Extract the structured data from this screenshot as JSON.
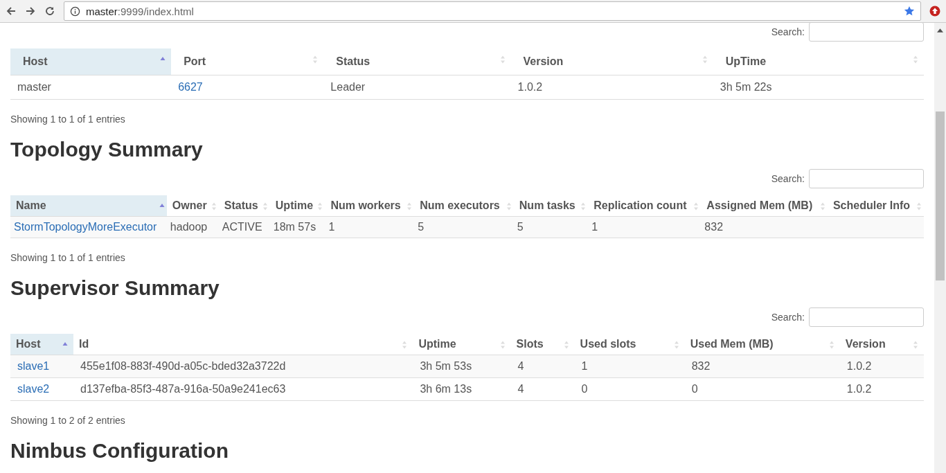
{
  "browser": {
    "url_host": "master",
    "url_rest": ":9999/index.html"
  },
  "sections": [
    {
      "search_label": "Search:",
      "table": {
        "columns": [
          {
            "label": "Host",
            "sorted": true,
            "link": false
          },
          {
            "label": "Port",
            "sorted": false,
            "link": true
          },
          {
            "label": "Status",
            "sorted": false,
            "link": false
          },
          {
            "label": "Version",
            "sorted": false,
            "link": false
          },
          {
            "label": "UpTime",
            "sorted": false,
            "link": false
          }
        ],
        "rows": [
          [
            "master",
            "6627",
            "Leader",
            "1.0.2",
            "3h 5m 22s"
          ]
        ]
      },
      "info": "Showing 1 to 1 of 1 entries"
    },
    {
      "heading": "Topology Summary",
      "search_label": "Search:",
      "table": {
        "columns": [
          {
            "label": "Name",
            "sorted": true,
            "link": true
          },
          {
            "label": "Owner",
            "sorted": false,
            "link": false
          },
          {
            "label": "Status",
            "sorted": false,
            "link": false
          },
          {
            "label": "Uptime",
            "sorted": false,
            "link": false
          },
          {
            "label": "Num workers",
            "sorted": false,
            "link": false
          },
          {
            "label": "Num executors",
            "sorted": false,
            "link": false
          },
          {
            "label": "Num tasks",
            "sorted": false,
            "link": false
          },
          {
            "label": "Replication count",
            "sorted": false,
            "link": false
          },
          {
            "label": "Assigned Mem (MB)",
            "sorted": false,
            "link": false
          },
          {
            "label": "Scheduler Info",
            "sorted": false
          }
        ],
        "rows": [
          [
            "StormTopologyMoreExecutor",
            "hadoop",
            "ACTIVE",
            "18m 57s",
            "1",
            "5",
            "5",
            "1",
            "832",
            ""
          ]
        ]
      },
      "info": "Showing 1 to 1 of 1 entries"
    },
    {
      "heading": "Supervisor Summary",
      "search_label": "Search:",
      "table": {
        "columns": [
          {
            "label": "Host",
            "sorted": true,
            "link": true
          },
          {
            "label": "Id",
            "sorted": false,
            "link": false
          },
          {
            "label": "Uptime",
            "sorted": false,
            "link": false
          },
          {
            "label": "Slots",
            "sorted": false,
            "link": false
          },
          {
            "label": "Used slots",
            "sorted": false,
            "link": false
          },
          {
            "label": "Used Mem (MB)",
            "sorted": false,
            "link": false
          },
          {
            "label": "Version",
            "sorted": false,
            "link": false
          }
        ],
        "rows": [
          [
            "slave1",
            "455e1f08-883f-490d-a05c-bded32a3722d",
            "3h 5m 53s",
            "4",
            "1",
            "832",
            "1.0.2"
          ],
          [
            "slave2",
            "d137efba-85f3-487a-916a-50a9e241ec63",
            "3h 6m 13s",
            "4",
            "0",
            "0",
            "1.0.2"
          ]
        ]
      },
      "info": "Showing 1 to 2 of 2 entries"
    },
    {
      "heading": "Nimbus Configuration"
    }
  ]
}
